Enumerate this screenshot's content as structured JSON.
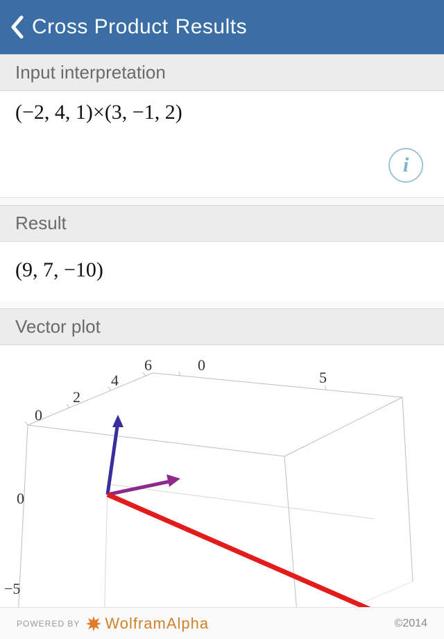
{
  "header": {
    "app_title": "Cross Product",
    "page_title": "Results"
  },
  "sections": {
    "input_interpretation": {
      "label": "Input interpretation",
      "expression": "(−2, 4, 1)×(3, −1, 2)"
    },
    "result": {
      "label": "Result",
      "value": "(9, 7, −10)"
    },
    "vector_plot": {
      "label": "Vector plot",
      "axis_ticks": {
        "top_back": [
          "0",
          "5"
        ],
        "top_left": [
          "0",
          "2",
          "4",
          "6"
        ],
        "left_vertical": [
          "0",
          "−5"
        ]
      }
    }
  },
  "footer": {
    "powered_by_label": "POWERED BY",
    "brand": "WolframAlpha",
    "copyright": "©2014"
  },
  "chart_data": {
    "type": "3d_vector_plot",
    "vectors": [
      {
        "name": "a",
        "components": [
          -2,
          4,
          1
        ],
        "color": "#3a2e9e"
      },
      {
        "name": "b",
        "components": [
          3,
          -1,
          2
        ],
        "color": "#8e2a8e"
      },
      {
        "name": "a_cross_b",
        "components": [
          9,
          7,
          -10
        ],
        "color": "#e21b1b"
      }
    ],
    "axes": {
      "x_range": [
        -2,
        9
      ],
      "y_range": [
        -1,
        7
      ],
      "z_range": [
        -10,
        2
      ]
    }
  }
}
